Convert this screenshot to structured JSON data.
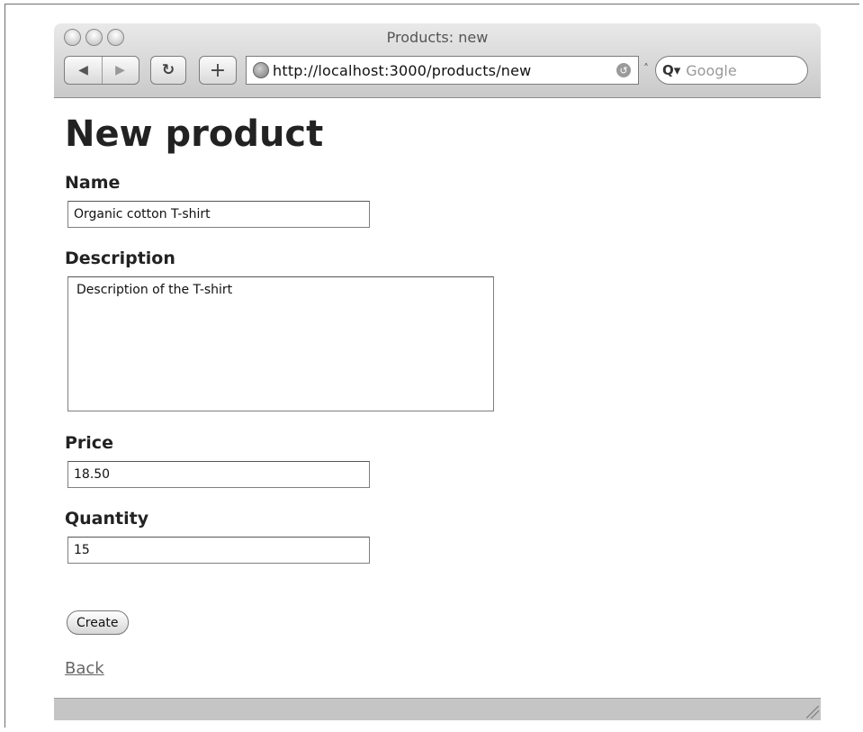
{
  "window": {
    "title": "Products: new",
    "url": "http://localhost:3000/products/new",
    "search_placeholder": "Google",
    "nav_back_glyph": "◀",
    "nav_forward_glyph": "▶",
    "reload_glyph": "↻",
    "add_glyph": "+"
  },
  "page": {
    "heading": "New product",
    "fields": {
      "name": {
        "label": "Name",
        "value": "Organic cotton T-shirt"
      },
      "description": {
        "label": "Description",
        "value": "Description of the T-shirt"
      },
      "price": {
        "label": "Price",
        "value": "18.50"
      },
      "quantity": {
        "label": "Quantity",
        "value": "15"
      }
    },
    "submit_label": "Create",
    "back_link": "Back"
  }
}
